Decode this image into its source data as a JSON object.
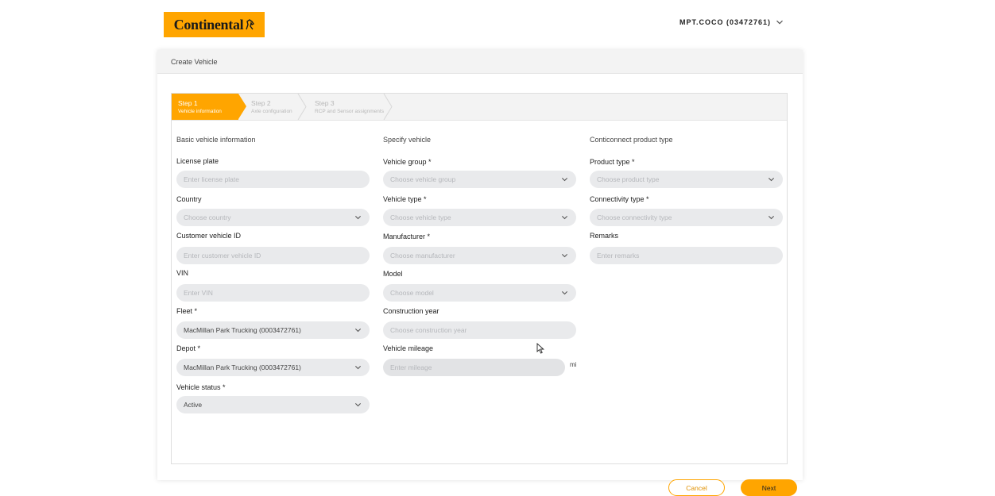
{
  "brand": {
    "logo_text": "Continental",
    "accent": "#ffa500"
  },
  "account": {
    "label": "MPT.COCO (03472761)"
  },
  "panel": {
    "title": "Create Vehicle"
  },
  "steps": [
    {
      "title": "Step 1",
      "subtitle": "Vehicle information",
      "active": true
    },
    {
      "title": "Step 2",
      "subtitle": "Axle configuration",
      "active": false
    },
    {
      "title": "Step 3",
      "subtitle": "RCP and Sensor assignments",
      "active": false
    }
  ],
  "basic": {
    "title": "Basic vehicle information",
    "license_plate": {
      "label": "License plate",
      "placeholder": "Enter license plate"
    },
    "country": {
      "label": "Country",
      "placeholder": "Choose country"
    },
    "customer_vehicle_id": {
      "label": "Customer vehicle ID",
      "placeholder": "Enter customer vehicle ID"
    },
    "vin": {
      "label": "VIN",
      "placeholder": "Enter VIN"
    },
    "fleet": {
      "label": "Fleet *",
      "value": "MacMillan Park Trucking (0003472761)"
    },
    "depot": {
      "label": "Depot *",
      "value": "MacMillan Park Trucking (0003472761)"
    },
    "vehicle_status": {
      "label": "Vehicle status *",
      "value": "Active"
    }
  },
  "specify": {
    "title": "Specify vehicle",
    "vehicle_group": {
      "label": "Vehicle group *",
      "placeholder": "Choose vehicle group"
    },
    "vehicle_type": {
      "label": "Vehicle type *",
      "placeholder": "Choose vehicle type"
    },
    "manufacturer": {
      "label": "Manufacturer *",
      "placeholder": "Choose manufacturer"
    },
    "model": {
      "label": "Model",
      "placeholder": "Choose model"
    },
    "construction_year": {
      "label": "Construction year",
      "placeholder": "Choose construction year"
    },
    "vehicle_mileage": {
      "label": "Vehicle mileage",
      "placeholder": "Enter mileage",
      "unit": "mi"
    }
  },
  "product": {
    "title": "Conticonnect product type",
    "product_type": {
      "label": "Product type *",
      "placeholder": "Choose product type"
    },
    "connectivity_type": {
      "label": "Connectivity type *",
      "placeholder": "Choose connectivity type"
    },
    "remarks": {
      "label": "Remarks",
      "placeholder": "Enter remarks"
    }
  },
  "actions": {
    "cancel": "Cancel",
    "next": "Next"
  }
}
